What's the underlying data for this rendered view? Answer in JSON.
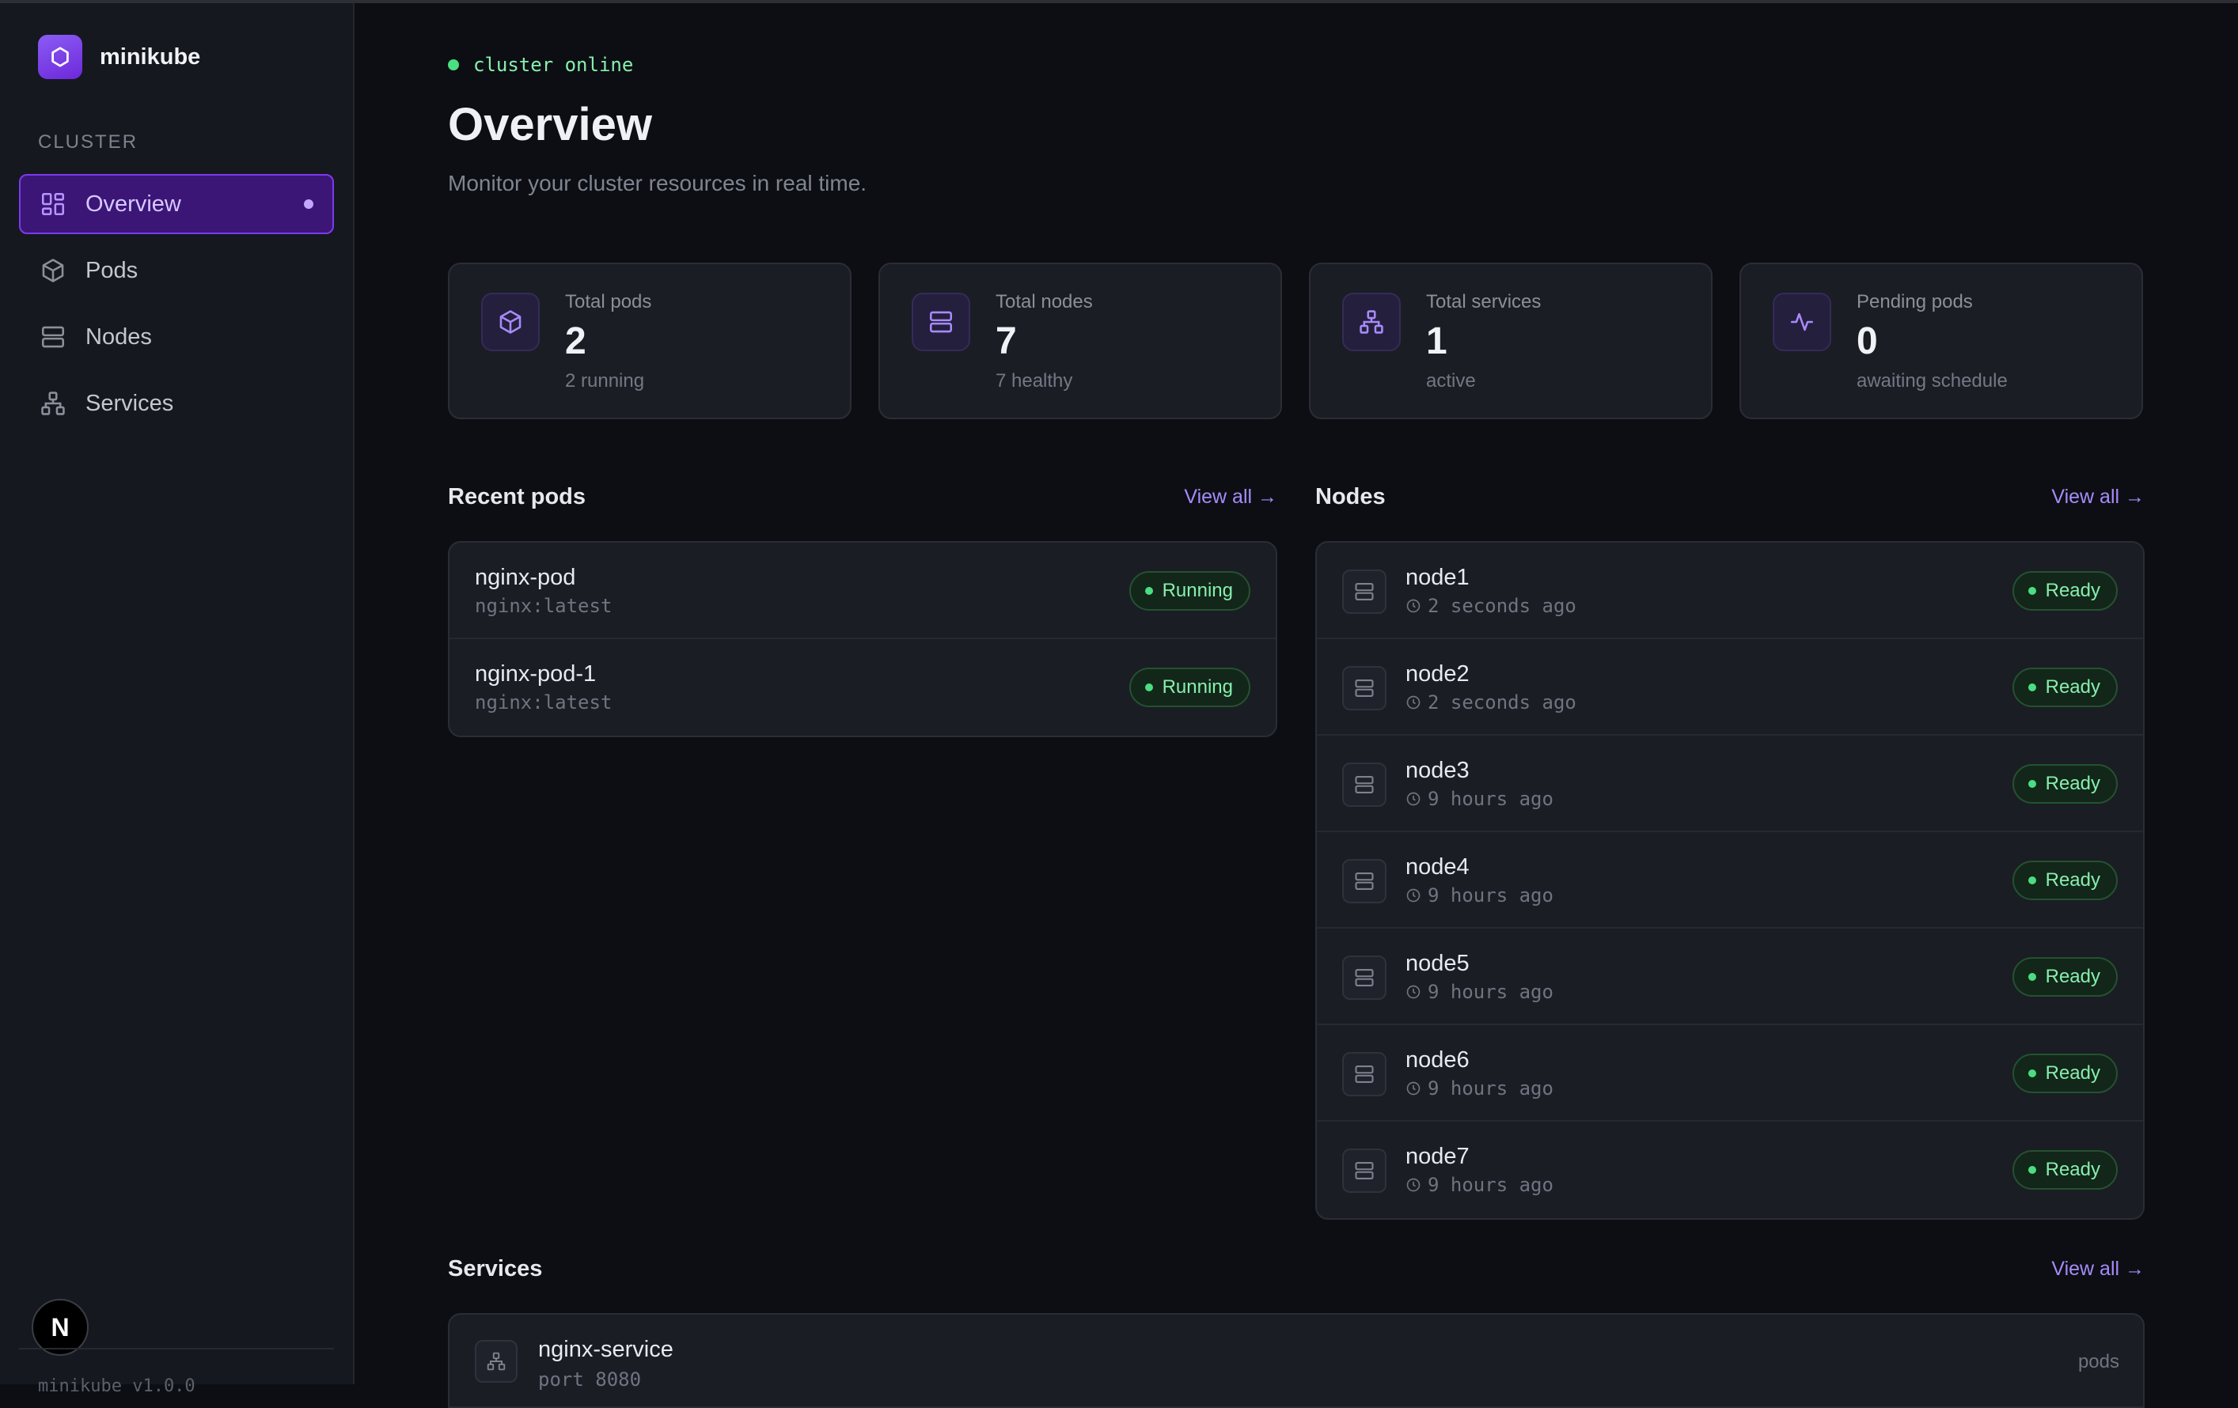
{
  "brand": {
    "name": "minikube"
  },
  "sidebar": {
    "section_label": "CLUSTER",
    "items": [
      {
        "label": "Overview",
        "icon": "dashboard-grid-icon",
        "active": true
      },
      {
        "label": "Pods",
        "icon": "cube-icon",
        "active": false
      },
      {
        "label": "Nodes",
        "icon": "server-icon",
        "active": false
      },
      {
        "label": "Services",
        "icon": "network-icon",
        "active": false
      }
    ],
    "footer": "minikube v1.0.0",
    "next_badge": "N"
  },
  "header": {
    "status": "cluster online",
    "title": "Overview",
    "subtitle": "Monitor your cluster resources in real time."
  },
  "stats": [
    {
      "label": "Total pods",
      "value": "2",
      "sub": "2 running",
      "icon": "cube-icon"
    },
    {
      "label": "Total nodes",
      "value": "7",
      "sub": "7 healthy",
      "icon": "server-icon"
    },
    {
      "label": "Total services",
      "value": "1",
      "sub": "active",
      "icon": "network-icon"
    },
    {
      "label": "Pending pods",
      "value": "0",
      "sub": "awaiting schedule",
      "icon": "activity-icon"
    }
  ],
  "recent_pods": {
    "title": "Recent pods",
    "view_all": "View all →",
    "items": [
      {
        "name": "nginx-pod",
        "image": "nginx:latest",
        "status": "Running"
      },
      {
        "name": "nginx-pod-1",
        "image": "nginx:latest",
        "status": "Running"
      }
    ]
  },
  "nodes": {
    "title": "Nodes",
    "view_all": "View all →",
    "items": [
      {
        "name": "node1",
        "age": "2 seconds ago",
        "status": "Ready"
      },
      {
        "name": "node2",
        "age": "2 seconds ago",
        "status": "Ready"
      },
      {
        "name": "node3",
        "age": "9 hours ago",
        "status": "Ready"
      },
      {
        "name": "node4",
        "age": "9 hours ago",
        "status": "Ready"
      },
      {
        "name": "node5",
        "age": "9 hours ago",
        "status": "Ready"
      },
      {
        "name": "node6",
        "age": "9 hours ago",
        "status": "Ready"
      },
      {
        "name": "node7",
        "age": "9 hours ago",
        "status": "Ready"
      }
    ]
  },
  "services": {
    "title": "Services",
    "view_all": "View all →",
    "items": [
      {
        "name": "nginx-service",
        "port": "port 8080",
        "right": "pods"
      }
    ]
  },
  "colors": {
    "accent": "#7c3aed",
    "success": "#4ade80",
    "background": "#0c0e13",
    "card": "#1a1d24"
  }
}
